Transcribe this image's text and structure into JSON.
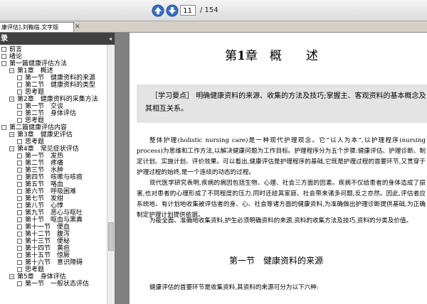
{
  "toolbar": {
    "page_current": "11",
    "page_total": "/ 154"
  },
  "tab": {
    "label": "康评估].刘鞠临.文字版",
    "close": "✕"
  },
  "sidebar": {
    "title": "录",
    "collapse": "◂",
    "items": [
      {
        "label": "前言",
        "indent": 0,
        "icon": "box"
      },
      {
        "label": "绪论",
        "indent": 0,
        "icon": "box"
      },
      {
        "label": "第一篇健康评估方法",
        "indent": 0,
        "icon": "box"
      },
      {
        "label": "第1章　概述",
        "indent": 1,
        "icon": "expanded"
      },
      {
        "label": "第一节　健康资料的来源",
        "indent": 2,
        "icon": "box"
      },
      {
        "label": "第二节　健康资料的类型",
        "indent": 2,
        "icon": "box"
      },
      {
        "label": "思考题",
        "indent": 2,
        "icon": "box"
      },
      {
        "label": "第2章　健康资料的采集方法",
        "indent": 1,
        "icon": "expanded"
      },
      {
        "label": "第一节　交谈",
        "indent": 2,
        "icon": "box"
      },
      {
        "label": "第二节　身体评估",
        "indent": 2,
        "icon": "box"
      },
      {
        "label": "思考题",
        "indent": 2,
        "icon": "box"
      },
      {
        "label": "第二篇健康评估内容",
        "indent": 0,
        "icon": "box"
      },
      {
        "label": "第3章　健康史评估",
        "indent": 1,
        "icon": "expanded"
      },
      {
        "label": "思考题",
        "indent": 2,
        "icon": "box"
      },
      {
        "label": "第4章　常见症状评估",
        "indent": 1,
        "icon": "expanded"
      },
      {
        "label": "第一节　发热",
        "indent": 2,
        "icon": "box"
      },
      {
        "label": "第二节　疼痛",
        "indent": 2,
        "icon": "box"
      },
      {
        "label": "第三节　水肿",
        "indent": 2,
        "icon": "box"
      },
      {
        "label": "第四节　咳嗽与咳痰",
        "indent": 2,
        "icon": "box"
      },
      {
        "label": "第五节　咯血",
        "indent": 2,
        "icon": "box"
      },
      {
        "label": "第六节　呼吸困难",
        "indent": 2,
        "icon": "box"
      },
      {
        "label": "第七节　发绀",
        "indent": 2,
        "icon": "box"
      },
      {
        "label": "第八节　心悸",
        "indent": 2,
        "icon": "box"
      },
      {
        "label": "第九节　恶心与呕吐",
        "indent": 2,
        "icon": "box"
      },
      {
        "label": "第十节　呕血与黑粪",
        "indent": 2,
        "icon": "box"
      },
      {
        "label": "第十一节　便血",
        "indent": 2,
        "icon": "box"
      },
      {
        "label": "第十二节　腹泻",
        "indent": 2,
        "icon": "box"
      },
      {
        "label": "第十三节　便秘",
        "indent": 2,
        "icon": "box"
      },
      {
        "label": "第十四节　黄疸",
        "indent": 2,
        "icon": "box"
      },
      {
        "label": "第十五节　惊厥",
        "indent": 2,
        "icon": "box"
      },
      {
        "label": "第十六节　意识障碍",
        "indent": 2,
        "icon": "box"
      },
      {
        "label": "思考题",
        "indent": 2,
        "icon": "box"
      },
      {
        "label": "第5章　身体评估",
        "indent": 1,
        "icon": "expanded"
      },
      {
        "label": "第一节　一般状态评估",
        "indent": 2,
        "icon": "box"
      }
    ]
  },
  "document": {
    "chapter_prefix": "第",
    "chapter_number": "1",
    "chapter_suffix": "章　概　　述",
    "points_label": "［学习要点］",
    "points_text": "明确健康资料的来源、收集的方法及技巧;掌握主、客观资料的基本概念及其相互关系。",
    "para1": "整体护理(holistic nursing care)是一种现代护理观念。它“以人为本”,以护理程序(nursing process)为思维和工作方法,以解决健康问题为工作目标。护理程序分为五个步骤:健康评估、护理诊断、制定计划、实施计划、评价效果。可以看出,健康评估是护理程序的基础,它既是护理过程的首要环节,又贯穿于护理过程的始终,是一个连续的动态的过程。",
    "para2": "现代医学研究表明,疾病的病因包括生物、心理、社会三方面的因素。疾病不仅给患者的身体造成了损害,也对患者的心理形成了不同程度的压力,同时还给其家庭、社会带来诸多问题,反之亦然。因此,评估者应系统地、有计划地收集被评估者的身、心、社会等诸方面的健康资料,为准确做出护理诊断提供基础,为正确制定护理计划提供依据。",
    "para3": "为能全面、准确地收集资料,护生必须明确资料的来源,资料的收集方法及技巧,资料的分类及价值。",
    "section_title": "第一节　健康资料的来源",
    "para4": "健康评估的首要环节是收集资料,其资料的来源可分为以下六种:"
  },
  "colors": {
    "toolbar": "#e6e6e6",
    "sidebar_header": "#404040",
    "points_box": "#e4e4e4",
    "nav_arrow": "#3a6fc4"
  }
}
